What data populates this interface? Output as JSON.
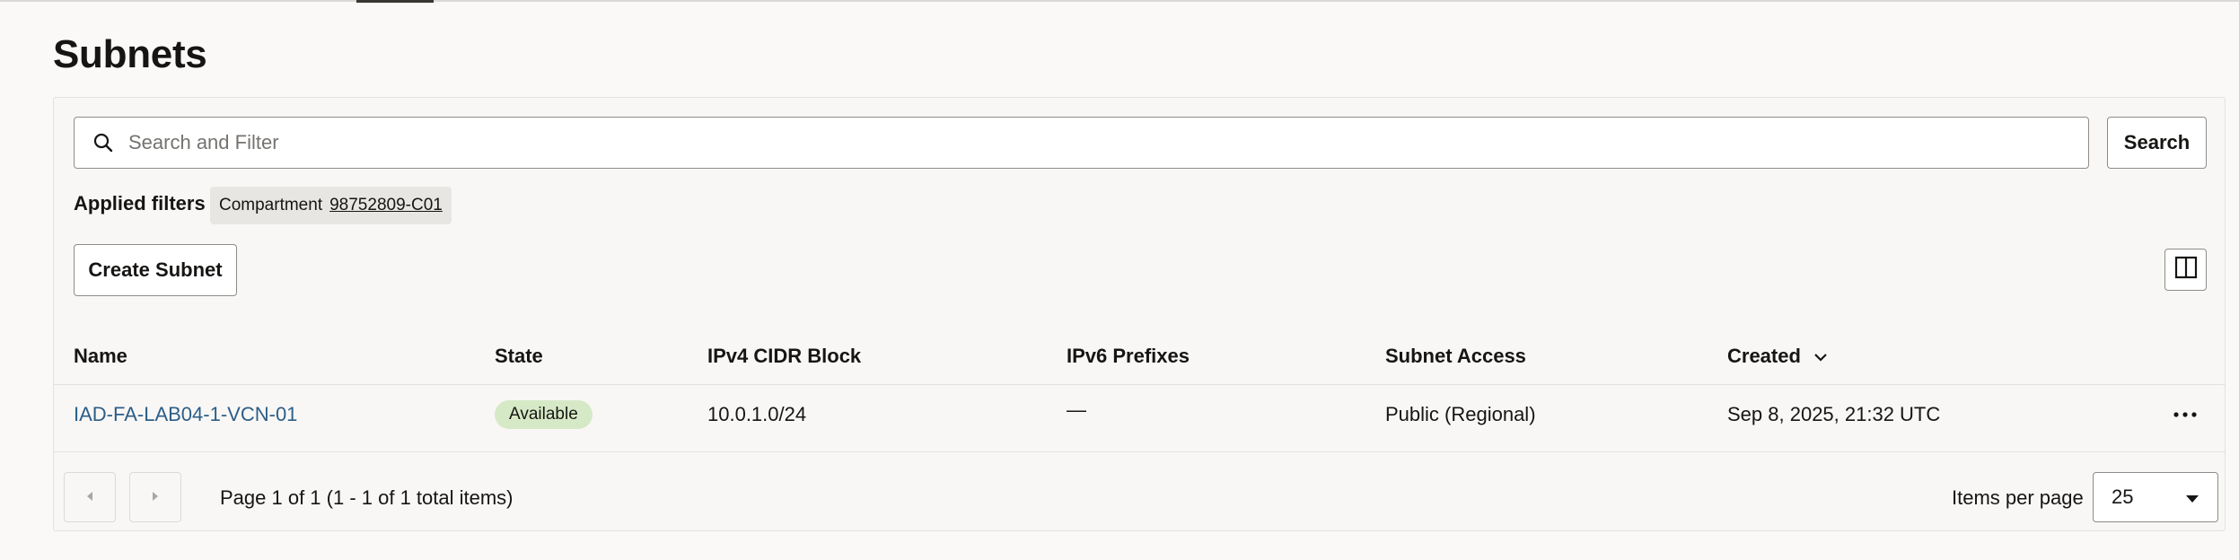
{
  "page": {
    "title": "Subnets"
  },
  "search": {
    "placeholder": "Search and Filter",
    "value": "",
    "button_label": "Search"
  },
  "filters": {
    "label": "Applied filters",
    "chips": [
      {
        "name": "Compartment",
        "value": "98752809-C01"
      }
    ]
  },
  "toolbar": {
    "create_label": "Create Subnet"
  },
  "table": {
    "columns": [
      "Name",
      "State",
      "IPv4 CIDR Block",
      "IPv6 Prefixes",
      "Subnet Access",
      "Created"
    ],
    "sort_column": "Created",
    "rows": [
      {
        "name": "IAD-FA-LAB04-1-VCN-01",
        "state": "Available",
        "ipv4": "10.0.1.0/24",
        "ipv6": "—",
        "access": "Public (Regional)",
        "created": "Sep 8, 2025, 21:32 UTC"
      }
    ]
  },
  "pagination": {
    "info": "Page 1 of 1 (1 - 1 of 1 total items)",
    "items_per_page_label": "Items per page",
    "items_per_page": "25"
  },
  "colors": {
    "link": "#2c5e88",
    "badge_available": "#d6e9c6",
    "background": "#fbf9f8"
  }
}
